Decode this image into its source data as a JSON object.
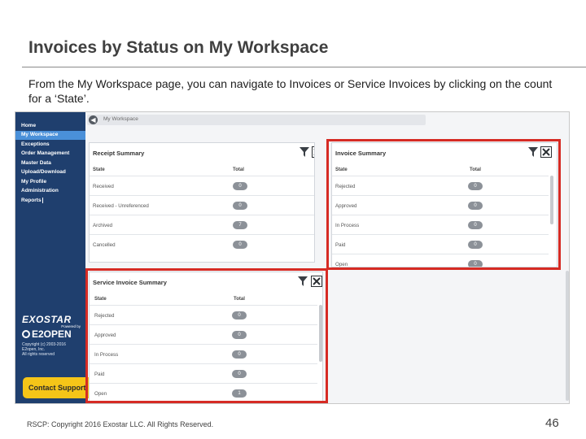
{
  "slide": {
    "title": "Invoices by Status on My Workspace",
    "body": "From the My Workspace page, you can navigate to Invoices or Service Invoices by clicking on the count for a ‘State’.",
    "footer": "RSCP: Copyright 2016 Exostar LLC. All Rights Reserved.",
    "page_number": "46"
  },
  "app": {
    "breadcrumb": "My Workspace",
    "highlight_color": "#d62b24",
    "sidebar": {
      "items": [
        {
          "label": "Home",
          "active": false
        },
        {
          "label": "My Workspace",
          "active": true
        },
        {
          "label": "Exceptions",
          "active": false
        },
        {
          "label": "Order Management",
          "active": false
        },
        {
          "label": "Master Data",
          "active": false
        },
        {
          "label": "Upload/Download",
          "active": false
        },
        {
          "label": "My Profile",
          "active": false
        },
        {
          "label": "Administration",
          "active": false
        },
        {
          "label": "Reports",
          "active": false
        }
      ],
      "brand": {
        "exostar": "EXOSTAR",
        "powered_by": "Powered by",
        "e2open": "E2OPEN",
        "copyright": [
          "Copyright (c) 2003-2016",
          "E2open, Inc.",
          "All rights reserved"
        ]
      },
      "contact_button": "Contact Support"
    },
    "panels": {
      "receipt": {
        "title": "Receipt Summary",
        "col_state": "State",
        "col_total": "Total",
        "rows": [
          {
            "state": "Received",
            "total": "0"
          },
          {
            "state": "Received - Unreferenced",
            "total": "0"
          },
          {
            "state": "Archived",
            "total": "7"
          },
          {
            "state": "Cancelled",
            "total": "0"
          }
        ]
      },
      "invoice": {
        "title": "Invoice Summary",
        "col_state": "State",
        "col_total": "Total",
        "rows": [
          {
            "state": "Rejected",
            "total": "0"
          },
          {
            "state": "Approved",
            "total": "0"
          },
          {
            "state": "In Process",
            "total": "0"
          },
          {
            "state": "Paid",
            "total": "0"
          },
          {
            "state": "Open",
            "total": "0"
          }
        ]
      },
      "service_invoice": {
        "title": "Service Invoice Summary",
        "col_state": "State",
        "col_total": "Total",
        "rows": [
          {
            "state": "Rejected",
            "total": "0"
          },
          {
            "state": "Approved",
            "total": "0"
          },
          {
            "state": "In Process",
            "total": "0"
          },
          {
            "state": "Paid",
            "total": "0"
          },
          {
            "state": "Open",
            "total": "1"
          }
        ]
      }
    }
  }
}
